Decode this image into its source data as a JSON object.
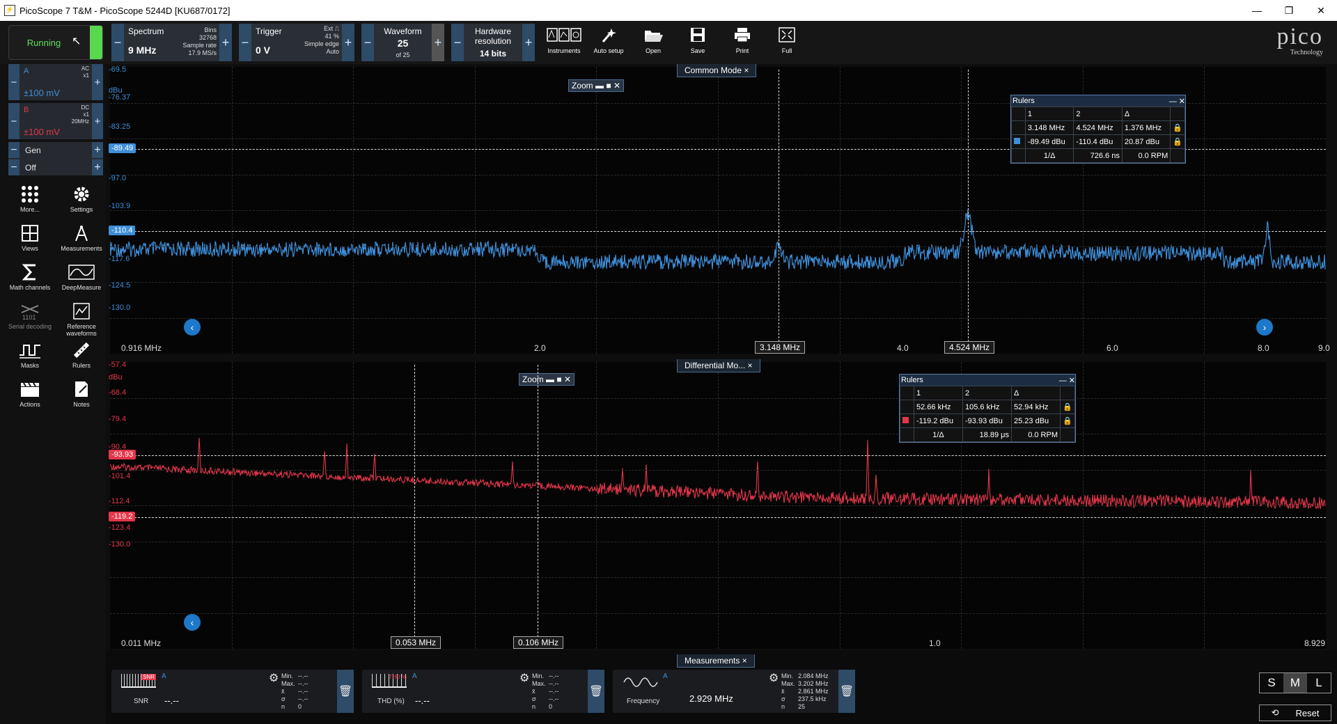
{
  "window": {
    "title": "PicoScope 7 T&M  - PicoScope 5244D [KU687/0172]"
  },
  "toolbar": {
    "run_status": "Running",
    "spectrum": {
      "label": "Spectrum",
      "value": "9 MHz",
      "bins_label": "Bins",
      "bins": "32768",
      "sample_rate_label": "Sample rate",
      "sample_rate": "17.9 MS/s"
    },
    "trigger": {
      "label": "Trigger",
      "value": "0 V",
      "source": "Ext",
      "percent": "41 %",
      "type": "Simple edge",
      "mode": "Auto"
    },
    "waveform": {
      "label": "Waveform",
      "value": "25",
      "of": "of 25"
    },
    "hardware_resolution": {
      "label": "Hardware resolution",
      "value": "14 bits"
    },
    "buttons": [
      {
        "label": "Instruments",
        "icon": "instruments-icon"
      },
      {
        "label": "Auto setup",
        "icon": "auto-setup-icon"
      },
      {
        "label": "Open",
        "icon": "folder-open-icon"
      },
      {
        "label": "Save",
        "icon": "save-icon"
      },
      {
        "label": "Print",
        "icon": "print-icon"
      },
      {
        "label": "Full",
        "icon": "fullscreen-icon"
      }
    ],
    "logo": "pico",
    "logo_sub": "Technology"
  },
  "channels": {
    "a": {
      "name": "A",
      "coupling": "AC",
      "probe": "x1",
      "range": "±100 mV",
      "color": "#3f8ed8"
    },
    "b": {
      "name": "B",
      "coupling": "DC",
      "probe": "x1",
      "bandwidth": "20MHz",
      "range": "±100 mV",
      "color": "#e4364a"
    },
    "gen": {
      "label": "Gen",
      "state": "Off"
    }
  },
  "sidebar": {
    "items": [
      {
        "label": "More...",
        "icon": "grid-dots-icon"
      },
      {
        "label": "Settings",
        "icon": "gear-icon"
      },
      {
        "label": "Views",
        "icon": "views-icon"
      },
      {
        "label": "Measurements",
        "icon": "caliper-icon"
      },
      {
        "label": "Math channels",
        "icon": "sigma-icon"
      },
      {
        "label": "DeepMeasure",
        "icon": "deepmeasure-icon"
      },
      {
        "label": "Serial decoding",
        "icon": "serial-decoding-icon"
      },
      {
        "label": "Reference waveforms",
        "icon": "reference-waveform-icon"
      },
      {
        "label": "Masks",
        "icon": "mask-icon"
      },
      {
        "label": "Rulers",
        "icon": "ruler-icon"
      },
      {
        "label": "Actions",
        "icon": "clapper-icon"
      },
      {
        "label": "Notes",
        "icon": "notes-icon"
      }
    ]
  },
  "views": {
    "top": {
      "title": "Common Mode",
      "unit": "dBu",
      "y_ticks": [
        "-69.5",
        "-76.37",
        "-83.25",
        "-97.0",
        "-103.9",
        "-117.6",
        "-124.5",
        "-130.0"
      ],
      "x_ticks": [
        "0.916 MHz",
        "2.0",
        "4.0",
        "6.0",
        "8.0",
        "9.0"
      ],
      "ruler_tags": {
        "v1": "3.148 MHz",
        "v2": "4.524 MHz",
        "h1": "-89.49",
        "h2": "-110.4"
      },
      "zoom_label": "Zoom",
      "rulers": {
        "title": "Rulers",
        "headers": [
          "1",
          "2",
          "Δ"
        ],
        "freq_row": [
          "3.148 MHz",
          "4.524 MHz",
          "1.376 MHz"
        ],
        "amp_row": [
          "-89.49 dBu",
          "-110.4 dBu",
          "20.87 dBu"
        ],
        "inv_label": "1/Δ",
        "inv_value": "726.6 ns",
        "rpm": "0.0 RPM"
      }
    },
    "bottom": {
      "title": "Differential Mo...",
      "unit": "dBu",
      "y_ticks": [
        "-57.4",
        "-68.4",
        "-79.4",
        "-90.4",
        "-101.4",
        "-112.4",
        "-123.4",
        "-130.0"
      ],
      "x_ticks": [
        "0.011 MHz",
        "1.0",
        "8.929"
      ],
      "ruler_tags": {
        "v1": "0.053 MHz",
        "v2": "0.106 MHz",
        "h1": "-93.93",
        "h2": "-119.2"
      },
      "zoom_label": "Zoom",
      "rulers": {
        "title": "Rulers",
        "headers": [
          "1",
          "2",
          "Δ"
        ],
        "freq_row": [
          "52.66 kHz",
          "105.6 kHz",
          "52.94 kHz"
        ],
        "amp_row": [
          "-119.2 dBu",
          "-93.93 dBu",
          "25.23 dBu"
        ],
        "inv_label": "1/Δ",
        "inv_value": "18.89 μs",
        "rpm": "0.0 RPM"
      }
    }
  },
  "measurements": {
    "title": "Measurements",
    "items": [
      {
        "name": "SNR",
        "channel": "A",
        "value": "--.--",
        "min_label": "Min.",
        "max_label": "Max.",
        "mean_label": "x̄",
        "sigma_label": "σ",
        "n_label": "n",
        "min": "--.--",
        "max": "--.--",
        "mean": "--.--",
        "sigma": "--.--",
        "n": "0",
        "icon_text": "SNR"
      },
      {
        "name": "THD (%)",
        "channel": "A",
        "value": "--.--",
        "min_label": "Min.",
        "max_label": "Max.",
        "mean_label": "x̄",
        "sigma_label": "σ",
        "n_label": "n",
        "min": "--.--",
        "max": "--.--",
        "mean": "--.--",
        "sigma": "--.--",
        "n": "0",
        "icon_text": "THD %"
      },
      {
        "name": "Frequency",
        "channel": "A",
        "value": "2.929 MHz",
        "min_label": "Min.",
        "max_label": "Max.",
        "mean_label": "x̄",
        "sigma_label": "σ",
        "n_label": "n",
        "min": "2.084 MHz",
        "max": "3.202 MHz",
        "mean": "2.861 MHz",
        "sigma": "237.5 kHz",
        "n": "25",
        "icon_text": ""
      }
    ],
    "size_buttons": [
      "S",
      "M",
      "L"
    ],
    "reset_label": "Reset"
  }
}
